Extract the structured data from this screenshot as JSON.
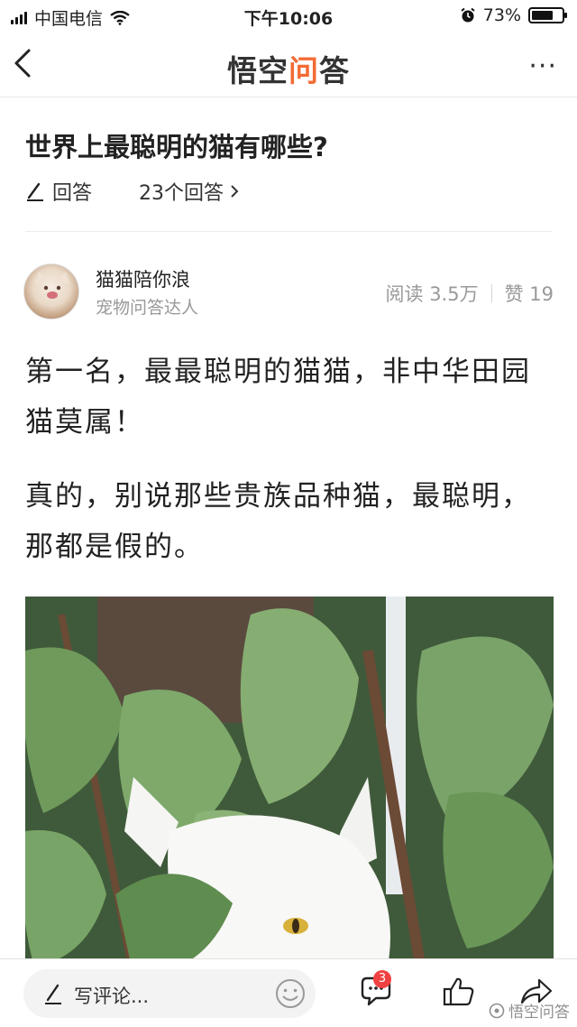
{
  "status_bar": {
    "carrier": "中国电信",
    "time": "下午10:06",
    "battery_percent": "73%",
    "battery_level": 0.73
  },
  "nav": {
    "logo_main": "悟空",
    "logo_accent": "问",
    "logo_end": "答",
    "more_label": "···"
  },
  "question": {
    "title": "世界上最聪明的猫有哪些?",
    "answer_label": "回答",
    "answer_count": "23个回答"
  },
  "author": {
    "name": "猫猫陪你浪",
    "title": "宠物问答达人",
    "reads": "阅读 3.5万",
    "likes": "赞 19"
  },
  "content": {
    "paragraph_1": "第一名，最最聪明的猫猫，非中华田园猫莫属！",
    "paragraph_2": "真的，别说那些贵族品种猫，最聪明，那都是假的。"
  },
  "bottom_bar": {
    "comment_placeholder": "写评论...",
    "comment_badge": "3",
    "watermark": "悟空问答"
  },
  "colors": {
    "accent": "#f36b34",
    "badge": "#f04142",
    "leaf": "#6f9a5c"
  },
  "icons": [
    "back-icon",
    "more-icon",
    "pencil-icon",
    "chevron-right-icon",
    "emoji-icon",
    "comment-icon",
    "thumbs-up-icon",
    "share-icon"
  ]
}
